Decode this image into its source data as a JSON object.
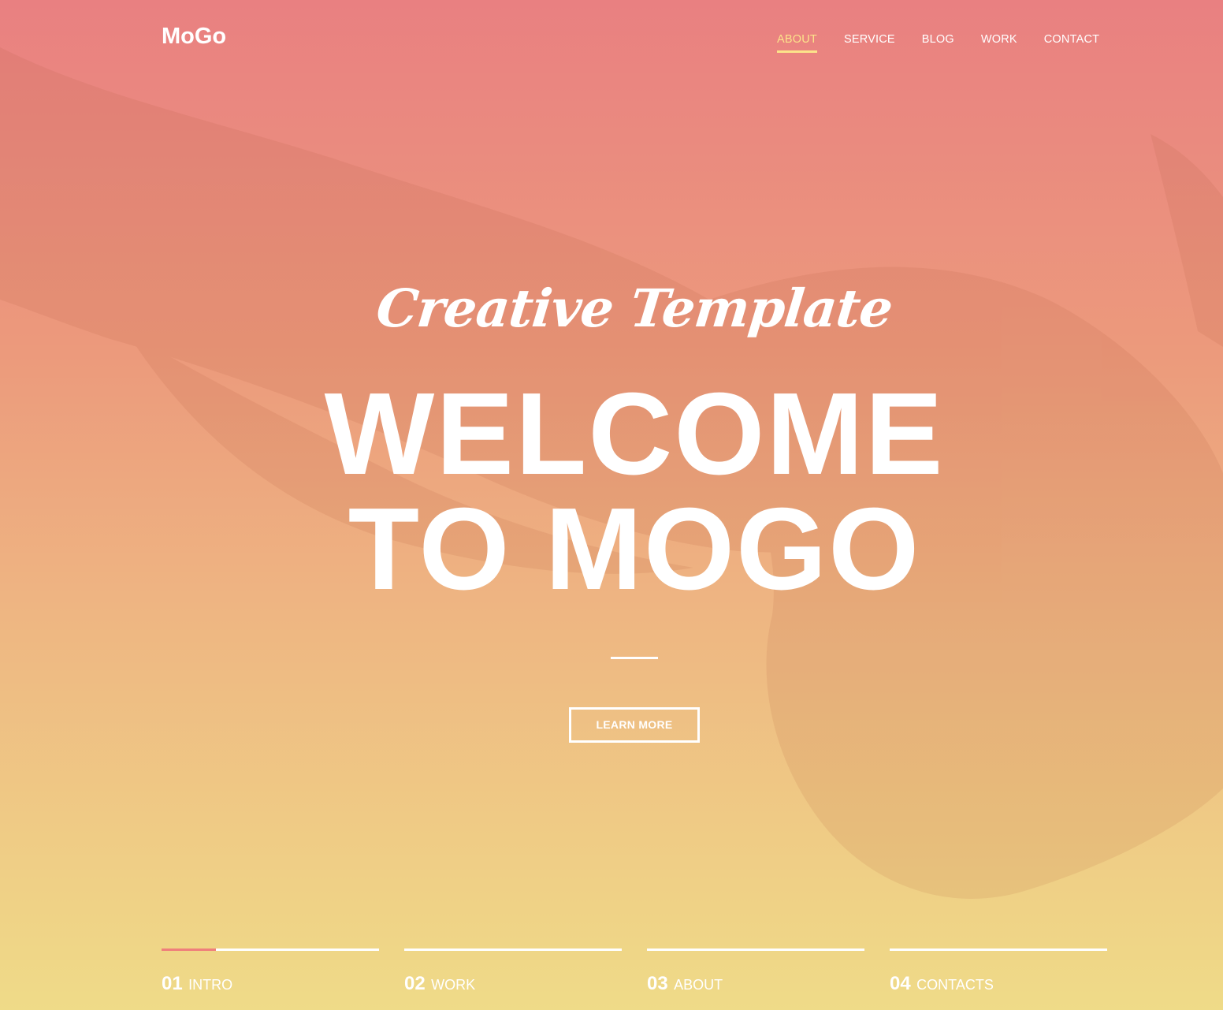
{
  "header": {
    "logo": "MoGo",
    "nav": [
      {
        "label": "ABOUT",
        "active": true
      },
      {
        "label": "SERVICE",
        "active": false
      },
      {
        "label": "BLOG",
        "active": false
      },
      {
        "label": "WORK",
        "active": false
      },
      {
        "label": "CONTACT",
        "active": false
      }
    ]
  },
  "hero": {
    "subtitle": "Creative Template",
    "title_line1": "WELCOME",
    "title_line2": "TO MOGO",
    "button_label": "LEARN MORE"
  },
  "slider": {
    "tabs": [
      {
        "number": "01",
        "label": "INTRO",
        "progress": 0.25
      },
      {
        "number": "02",
        "label": "WORK",
        "progress": 0
      },
      {
        "number": "03",
        "label": "ABOUT",
        "progress": 0
      },
      {
        "number": "04",
        "label": "CONTACTS",
        "progress": 0
      }
    ]
  },
  "colors": {
    "gradient_top": "#e98081",
    "gradient_bottom": "#efdb88",
    "accent_active_nav": "#fce38a",
    "progress_accent": "#ef7f7b"
  }
}
